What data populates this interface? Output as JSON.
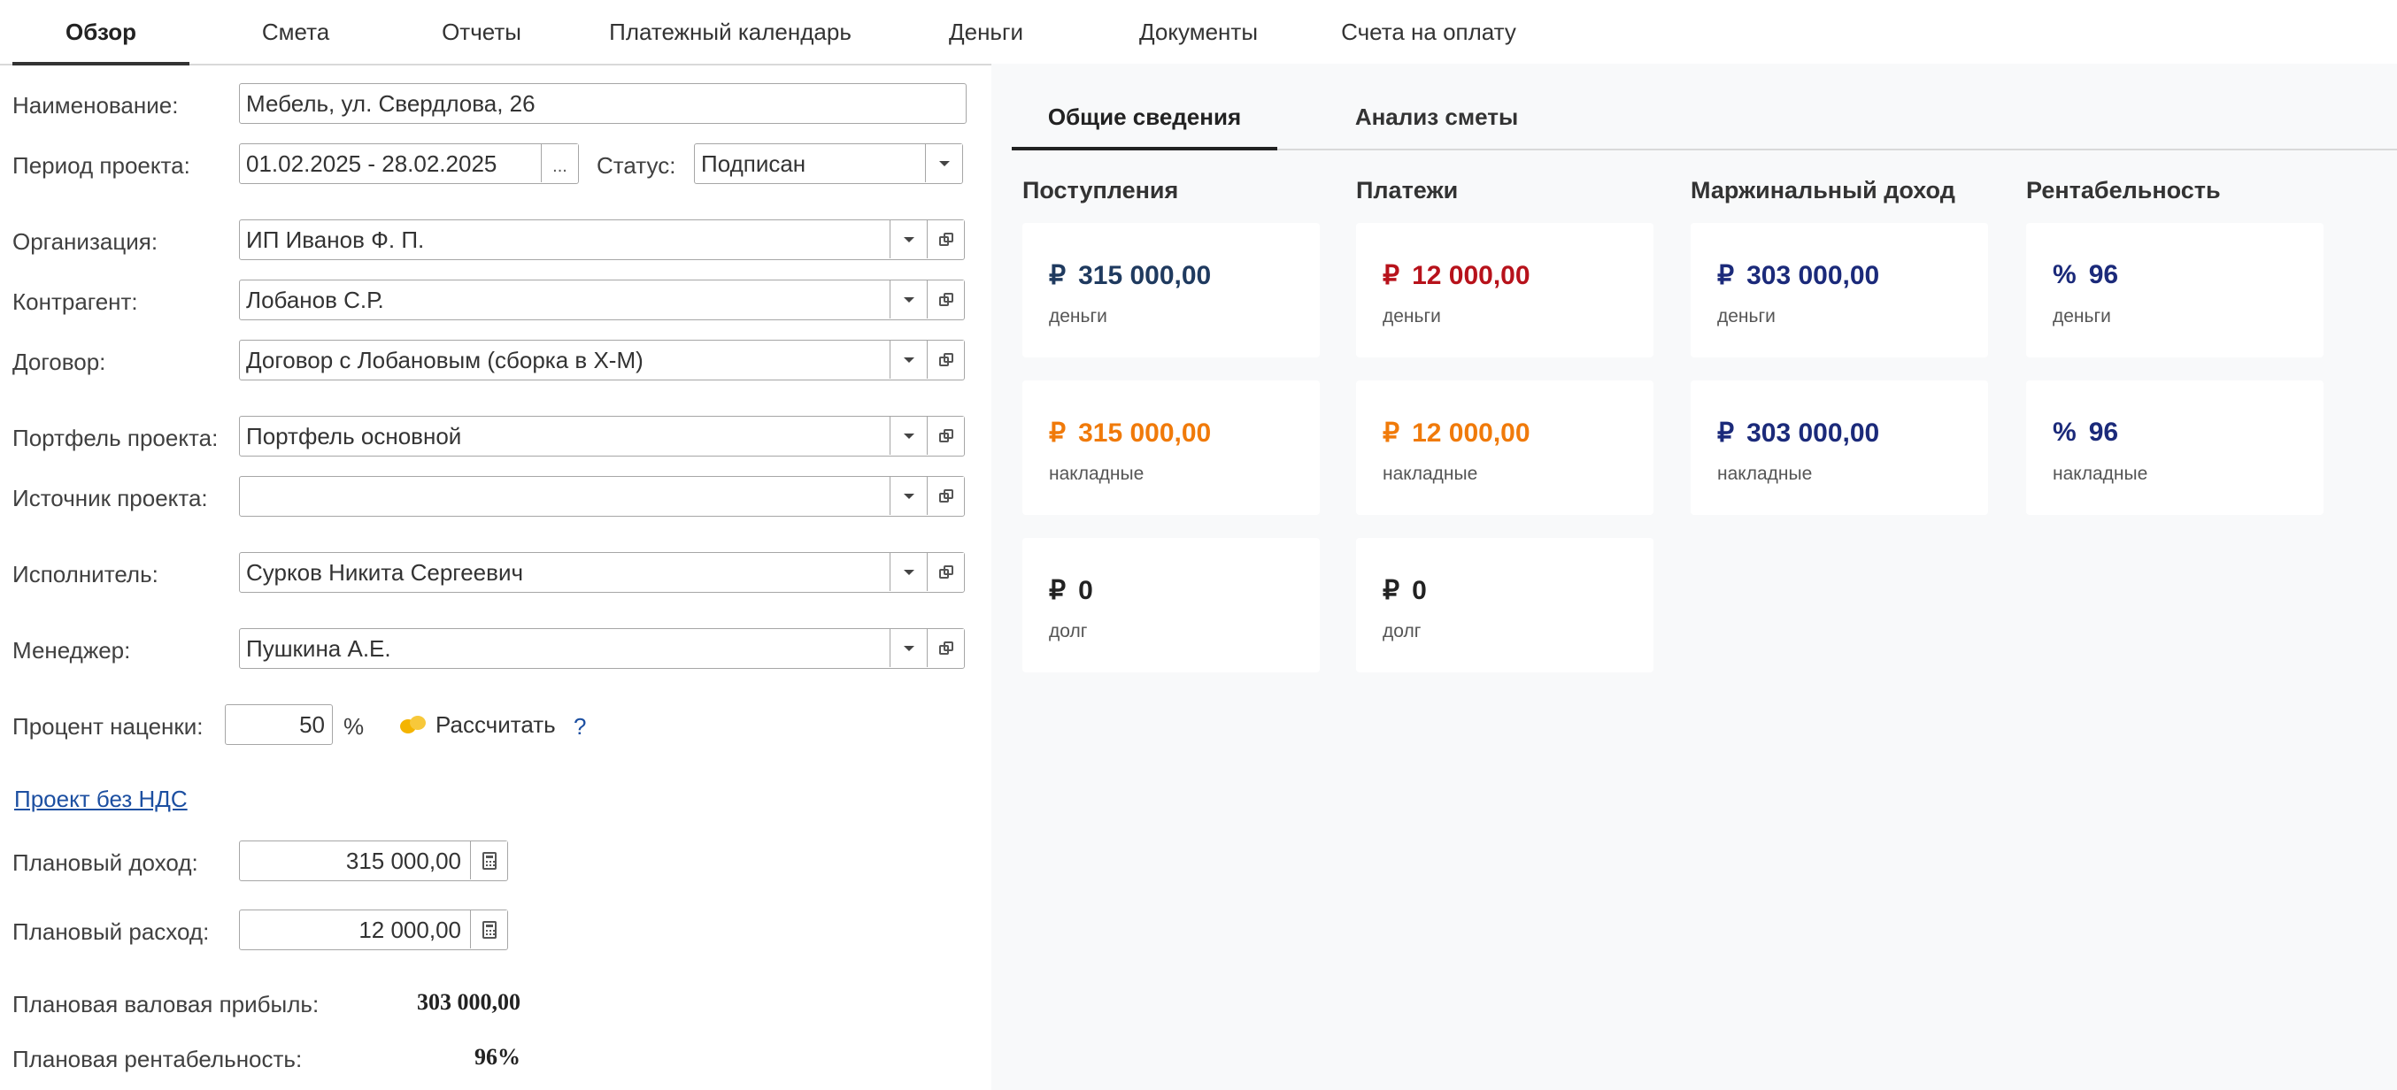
{
  "top_tabs": [
    "Обзор",
    "Смета",
    "Отчеты",
    "Платежный календарь",
    "Деньги",
    "Документы",
    "Счета на оплату"
  ],
  "form": {
    "name_label": "Наименование:",
    "name_value": "Мебель, ул. Свердлова, 26",
    "period_label": "Период проекта:",
    "period_value": "01.02.2025 - 28.02.2025",
    "period_button": "...",
    "status_label": "Статус:",
    "status_value": "Подписан",
    "org_label": "Организация:",
    "org_value": "ИП Иванов Ф. П.",
    "contractor_label": "Контрагент:",
    "contractor_value": "Лобанов С.Р.",
    "contract_label": "Договор:",
    "contract_value": "Договор с Лобановым (сборка в Х-М)",
    "portfolio_label": "Портфель проекта:",
    "portfolio_value": "Портфель основной",
    "source_label": "Источник проекта:",
    "source_value": "",
    "executor_label": "Исполнитель:",
    "executor_value": "Сурков Никита Сергеевич",
    "manager_label": "Менеджер:",
    "manager_value": "Пушкина А.Е.",
    "markup_label": "Процент наценки:",
    "markup_value": "50",
    "markup_unit": "%",
    "calculate_label": "Рассчитать",
    "help_label": "?",
    "vat_link": "Проект без НДС",
    "planned_income_label": "Плановый доход:",
    "planned_income_value": "315 000,00",
    "planned_expense_label": "Плановый расход:",
    "planned_expense_value": "12 000,00",
    "gross_profit_label": "Плановая валовая прибыль:",
    "gross_profit_value": "303 000,00",
    "profitability_label": "Плановая рентабельность:",
    "profitability_value": "96%"
  },
  "right": {
    "tabs": [
      "Общие сведения",
      "Анализ сметы"
    ],
    "columns": [
      "Поступления",
      "Платежи",
      "Маржинальный доход",
      "Рентабельность"
    ],
    "cards": [
      [
        {
          "symbol": "₽",
          "amount": "315 000,00",
          "label": "деньги",
          "color": "#1f3a5f"
        },
        {
          "symbol": "₽",
          "amount": "315 000,00",
          "label": "накладные",
          "color": "#f07a0a"
        },
        {
          "symbol": "₽",
          "amount": "0",
          "label": "долг",
          "color": "#222222"
        }
      ],
      [
        {
          "symbol": "₽",
          "amount": "12 000,00",
          "label": "деньги",
          "color": "#b7121b"
        },
        {
          "symbol": "₽",
          "amount": "12 000,00",
          "label": "накладные",
          "color": "#f07a0a"
        },
        {
          "symbol": "₽",
          "amount": "0",
          "label": "долг",
          "color": "#222222"
        }
      ],
      [
        {
          "symbol": "₽",
          "amount": "303 000,00",
          "label": "деньги",
          "color": "#1b2a7a"
        },
        {
          "symbol": "₽",
          "amount": "303 000,00",
          "label": "накладные",
          "color": "#1b2a7a"
        }
      ],
      [
        {
          "symbol": "%",
          "amount": "96",
          "label": "деньги",
          "color": "#1b2a7a"
        },
        {
          "symbol": "%",
          "amount": "96",
          "label": "накладные",
          "color": "#1b2a7a"
        }
      ]
    ]
  }
}
